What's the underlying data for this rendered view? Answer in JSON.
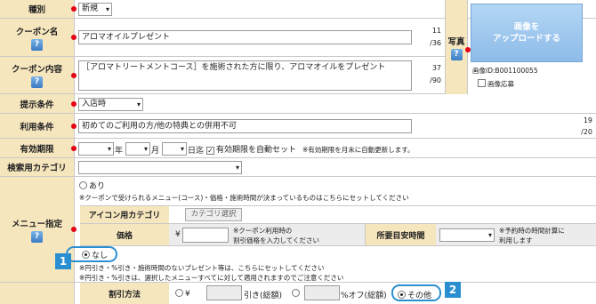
{
  "type": {
    "label": "種別",
    "value": "新規"
  },
  "coupon_name": {
    "label": "クーポン名",
    "value": "アロマオイルプレゼント",
    "count": "11",
    "max": "/36"
  },
  "coupon_content": {
    "label": "クーポン内容",
    "value": "［アロマトリートメントコース］を施術された方に限り、アロマオイルをプレゼント",
    "count": "37",
    "max": "/90"
  },
  "photo": {
    "label": "写真",
    "upload_label": "画像を\nアップロードする",
    "image_id": "画像ID:B001100055",
    "apply_label": "画像応募"
  },
  "condition": {
    "label": "提示条件",
    "value": "入店時"
  },
  "usage": {
    "label": "利用条件",
    "value": "初めてのご利用の方/他の特典との併用不可",
    "count": "19",
    "max": "/20"
  },
  "expiry": {
    "label": "有効期限",
    "year": "年",
    "month": "月",
    "day": "日迄",
    "auto_label": "有効期限を自動セット",
    "note": "※有効期限を月末に自動更新します。"
  },
  "category": {
    "label": "検索用カテゴリ"
  },
  "menu": {
    "label": "メニュー指定",
    "yes": "あり",
    "yes_note": "※クーポンで受けられるメニュー(コース)・価格・施術時間が決まっているものはこちらにセットしてください",
    "icon_cat_label": "アイコン用カテゴリ",
    "cat_select_button": "カテゴリ選択",
    "price_label": "価格",
    "yen": "¥",
    "price_note": "※クーポン利用時の\n割引価格を入力してください",
    "duration_label": "所要目安時間",
    "duration_note": "※予約時の時間計算に\n利用します",
    "none": "なし",
    "none_note1": "※円引き・%引き・施術時間のないプレゼント等は、こちらにセットしてください",
    "none_note2": "※円引き・%引きは、選択したメニューすべてに対して適用されますのでご注意ください"
  },
  "discount": {
    "label": "割引方法",
    "yen": "¥",
    "yen_off": "引き(総額)",
    "pct_off": "%オフ(総額)",
    "other": "その他"
  },
  "badges": [
    "1",
    "2"
  ],
  "colors": {
    "label_bg": "#f6e6be",
    "required_dot": "#e60012",
    "accent": "#2a8fd0",
    "upload_bg": "#9ec8ee"
  }
}
